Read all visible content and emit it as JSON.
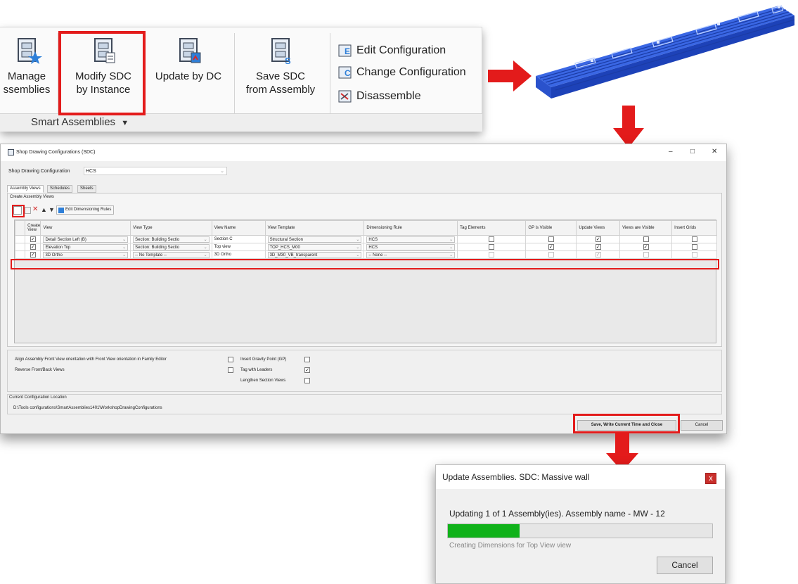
{
  "ribbon": {
    "buttons": [
      {
        "label": "Manage\nssemblies",
        "line1": "Manage",
        "line2": "ssemblies"
      },
      {
        "label": "Modify SDC by Instance",
        "line1": "Modify SDC",
        "line2": "by Instance"
      },
      {
        "label": "Update by DC",
        "line1": "Update by DC",
        "line2": ""
      },
      {
        "label": "Save SDC from Assembly",
        "line1": "Save SDC",
        "line2": "from Assembly"
      }
    ],
    "small_buttons": [
      "Edit Configuration",
      "Change Configuration",
      "Disassemble"
    ],
    "group_label": "Smart Assemblies",
    "group_chevron": "▼"
  },
  "sdc_dialog": {
    "title": "Shop Drawing Configurations (SDC)",
    "window_controls": [
      "–",
      "□",
      "✕"
    ],
    "config_label": "Shop Drawing Configuration",
    "config_value": "HCS",
    "tabs": [
      "Assembly Views",
      "Schedules",
      "Sheets"
    ],
    "group_title": "Create Assembly Views",
    "edit_rules_label": "Edit Dimensioning Rules",
    "columns": [
      "Create View",
      "View",
      "View Type",
      "View Name",
      "View Template",
      "Dimensioning Rule",
      "Tag Elements",
      "GP is Visible",
      "Update Views",
      "Views are Visible",
      "Insert Grids"
    ],
    "rows": [
      {
        "create": true,
        "view": "Detail Section Left (B)",
        "view_type": "Section: Building Sectio",
        "view_name": "Section C",
        "template": "Structural Section",
        "rule": "HCS",
        "tag": false,
        "gp": false,
        "update": true,
        "visible": false,
        "grids": false,
        "disabled": false
      },
      {
        "create": true,
        "view": "Elevation Top",
        "view_type": "Section: Building Sectio",
        "view_name": "Top view",
        "template": "TOP_HCS_M00",
        "rule": "HCS",
        "tag": false,
        "gp": true,
        "update": true,
        "visible": true,
        "grids": false,
        "disabled": false
      },
      {
        "create": true,
        "view": "3D Ortho",
        "view_type": "-- No Template --",
        "view_name": "3D Ortho",
        "template": "3D_M30_VB_transparent",
        "rule": "-- None --",
        "tag": false,
        "gp": false,
        "update": true,
        "visible": false,
        "grids": false,
        "disabled": true
      }
    ],
    "options": {
      "align_label": "Align Assembly Front View orientation with Front View orientation in Family Editor",
      "reverse_label": "Reverse Front/Back Views",
      "gp_label": "Insert Gravity Point (GP)",
      "leaders_label": "Tag with Leaders",
      "lengthen_label": "Lengthen Section Views"
    },
    "location_title": "Current Configuration Location",
    "location_path": "D:\\Tools configurations\\SmartAssemblies1401\\WorkshopDrawingConfigurations",
    "save_button": "Save, Write Current Time and Close",
    "cancel_button": "Cancel"
  },
  "progress_dialog": {
    "title": "Update Assemblies. SDC: Massive wall",
    "close": "x",
    "status": "Updating 1 of 1 Assembly(ies). Assembly name - MW - 12",
    "progress_fraction": 0.27,
    "substatus": "Creating Dimensions for Top View view",
    "cancel": "Cancel"
  },
  "colors": {
    "highlight_red": "#e31b1b",
    "progress_green": "#10b21a",
    "panel_blue": "#2255d6"
  }
}
